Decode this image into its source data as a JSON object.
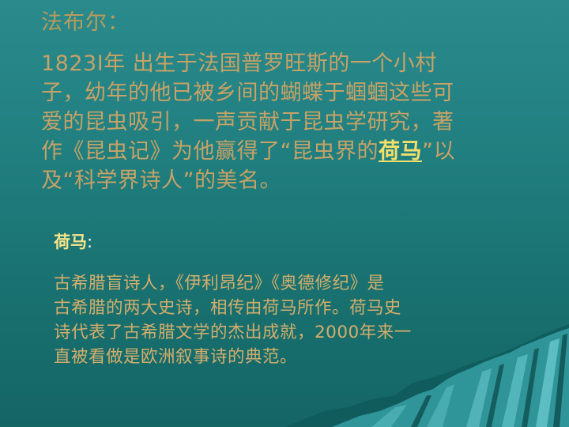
{
  "heading": "法布尔：",
  "main_lines": [
    "1823I年 出生于法国普罗旺斯的一个小村",
    "子，幼年的他已被乡间的蝴蝶于蝈蝈这些可",
    "爱的昆虫吸引，一声贡献于昆虫学研究，著"
  ],
  "main_line4_before": "作《昆虫记》为他赢得了“昆虫界的",
  "main_line4_link": "荷马",
  "main_line4_after": "”以",
  "main_line5": "及“科学界诗人”的美名。",
  "sub_heading_name": "荷马",
  "sub_heading_colon": ":",
  "sub_lines": [
    "古希腊盲诗人，《伊利昂纪》《奥德修纪》是",
    "古希腊的两大史诗，相传由荷马所作。荷马史",
    "诗代表了古希腊文学的杰出成就，2000年来一",
    "直被看做是欧洲叙事诗的典范。"
  ],
  "colors": {
    "background_top": "#2a8a8c",
    "background_bottom": "#146665",
    "heading_text": "#b89a5c",
    "body_text": "#c7a266",
    "link_text": "#f2e06a",
    "sub_heading_text": "#f5e58a",
    "mountain_light": "#3aa0a4",
    "mountain_dark": "#0f5a5c"
  }
}
